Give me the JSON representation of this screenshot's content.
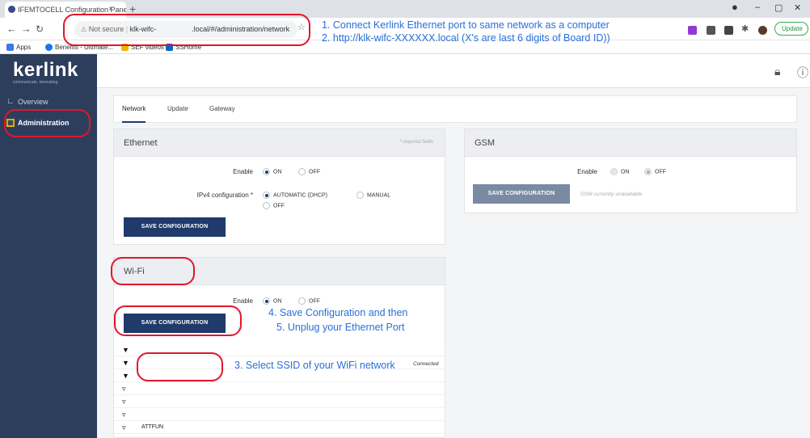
{
  "browser": {
    "tab_title": "IFEMTOCELL Configuration Panel",
    "tab_close": "×",
    "new_tab": "+",
    "win_min": "–",
    "win_max": "▢",
    "win_close": "✕",
    "addr_security": "Not secure",
    "addr_host_prefix": "klk-wifc-",
    "addr_host_suffix": ".local/#/administration/network",
    "update_label": "Update",
    "bookmarks": [
      "Apps",
      "Benefits - Ultimate...",
      "SEF videos",
      "SSHome"
    ]
  },
  "app": {
    "logo": "kerlink",
    "logo_tag": "communicate. innovating.",
    "sidebar": [
      {
        "label": "Overview",
        "icon": "chart-icon"
      },
      {
        "label": "Administration",
        "icon": "grid-icon"
      }
    ],
    "tabs": [
      "Network",
      "Update",
      "Gateway"
    ]
  },
  "ethernet": {
    "title": "Ethernet",
    "required": "* required fields",
    "enable_label": "Enable",
    "enable_options": [
      "ON",
      "OFF"
    ],
    "ipv4_label": "IPv4 configuration *",
    "ipv4_options": [
      "AUTOMATIC (DHCP)",
      "MANUAL",
      "OFF"
    ],
    "save_label": "SAVE CONFIGURATION"
  },
  "gsm": {
    "title": "GSM",
    "enable_label": "Enable",
    "enable_options": [
      "ON",
      "OFF"
    ],
    "save_label": "SAVE CONFIGURATION",
    "note": "GSM currently unavailable"
  },
  "wifi": {
    "title": "Wi-Fi",
    "enable_label": "Enable",
    "enable_options": [
      "ON",
      "OFF"
    ],
    "save_label": "SAVE CONFIGURATION",
    "networks": [
      "",
      "",
      "",
      "",
      "",
      "",
      "ATTFUN"
    ],
    "status_text": "Connected"
  },
  "annotations": {
    "step1": "1. Connect Kerlink Ethernet port to same network as a computer",
    "step2": "2. http://klk-wifc-XXXXXX.local (X's are last 6 digits of Board ID))",
    "step3": "3. Select SSID of your WiFi network",
    "step4": "4. Save Configuration and then",
    "step5": "5. Unplug your Ethernet Port"
  },
  "colors": {
    "sidebar": "#2c3e5c",
    "primary_button": "#1f3a6b",
    "annotation": "#2a6fd9",
    "highlight_ring": "#e2162a"
  }
}
